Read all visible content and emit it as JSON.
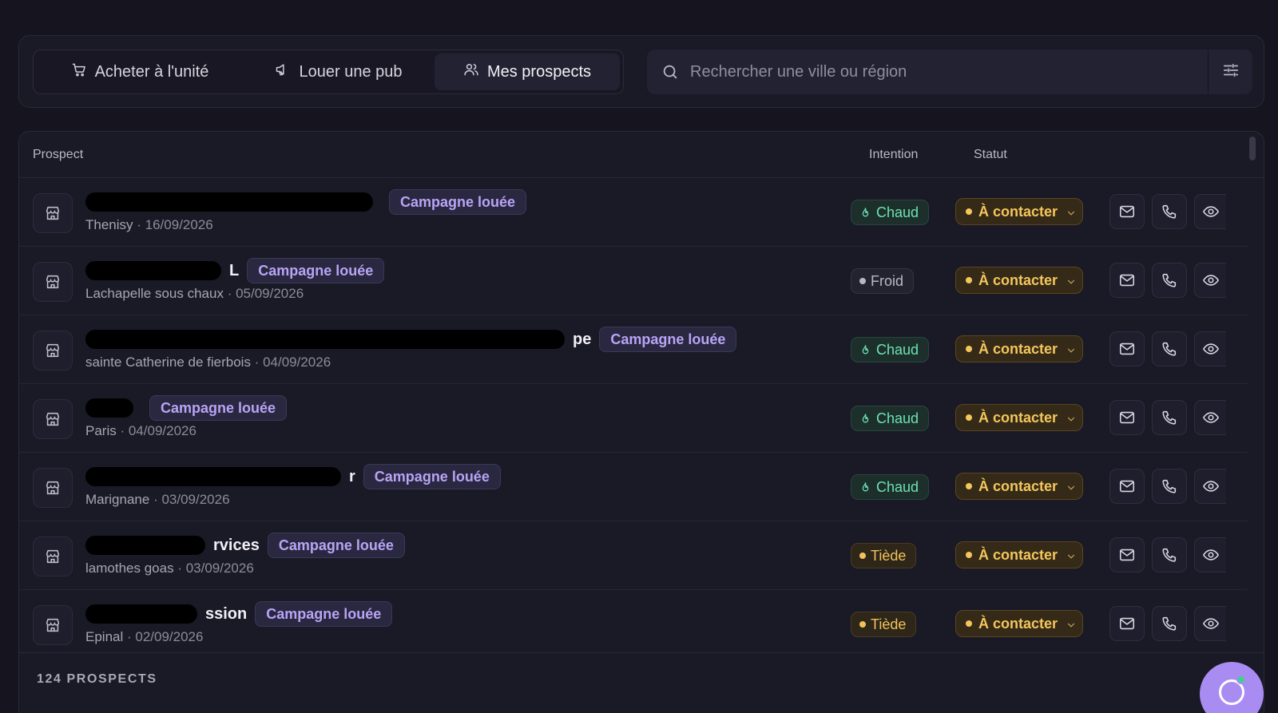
{
  "tabs": [
    {
      "label": "Acheter à l'unité",
      "icon": "cart-icon"
    },
    {
      "label": "Louer une pub",
      "icon": "megaphone-icon"
    },
    {
      "label": "Mes prospects",
      "icon": "users-icon",
      "active": true
    }
  ],
  "search": {
    "placeholder": "Rechercher une ville ou région",
    "value": ""
  },
  "table": {
    "headers": {
      "prospect": "Prospect",
      "intention": "Intention",
      "statut": "Statut"
    },
    "rows": [
      {
        "name_visible": "",
        "location": "Thenisy",
        "date": "· 16/09/2026",
        "badge": "Campagne louée",
        "intention": "Chaud",
        "intention_level": "chaud",
        "status": "À contacter"
      },
      {
        "name_visible": "L",
        "location": "Lachapelle sous chaux",
        "date": "· 05/09/2026",
        "badge": "Campagne louée",
        "intention": "Froid",
        "intention_level": "froid",
        "status": "À contacter"
      },
      {
        "name_visible": "pe",
        "location": "sainte Catherine de fierbois",
        "date": "· 04/09/2026",
        "badge": "Campagne louée",
        "intention": "Chaud",
        "intention_level": "chaud",
        "status": "À contacter"
      },
      {
        "name_visible": "",
        "location": "Paris",
        "date": "· 04/09/2026",
        "badge": "Campagne louée",
        "intention": "Chaud",
        "intention_level": "chaud",
        "status": "À contacter"
      },
      {
        "name_visible": "r",
        "location": "Marignane",
        "date": "· 03/09/2026",
        "badge": "Campagne louée",
        "intention": "Chaud",
        "intention_level": "chaud",
        "status": "À contacter"
      },
      {
        "name_visible": "rvices",
        "location": "lamothes goas",
        "date": "· 03/09/2026",
        "badge": "Campagne louée",
        "intention": "Tiède",
        "intention_level": "tiede",
        "status": "À contacter"
      },
      {
        "name_visible": "ssion",
        "location": "Epinal",
        "date": "· 02/09/2026",
        "badge": "Campagne louée",
        "intention": "Tiède",
        "intention_level": "tiede",
        "status": "À contacter"
      }
    ]
  },
  "footer": {
    "count_label": "124 PROSPECTS"
  },
  "colors": {
    "accent": "#b9a4f5",
    "chaud": "#6ee2b3",
    "tiede": "#f2c25a",
    "status": "#f5c65c"
  }
}
